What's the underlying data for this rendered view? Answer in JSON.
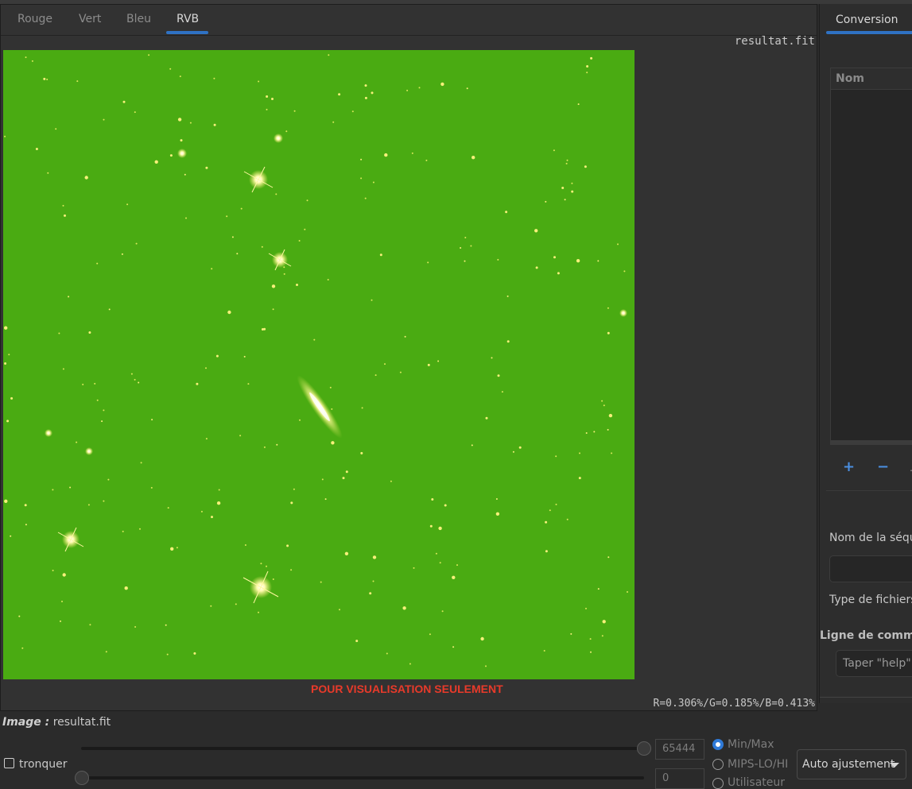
{
  "viewer": {
    "tabs": [
      "Rouge",
      "Vert",
      "Bleu",
      "RVB"
    ],
    "active_tab": "RVB",
    "filename": "resultat.fit",
    "watermark": "POUR VISUALISATION SEULEMENT",
    "pixel_readout": "R=0.306%/G=0.185%/B=0.413%"
  },
  "right_panel": {
    "tab": "Conversion",
    "list_header": "Nom",
    "add_symbol": "+",
    "remove_symbol": "−",
    "sequence_name_label": "Nom de la séqu",
    "file_type_label": "Type de fichiers",
    "command_line_label": "Ligne de comman",
    "command_placeholder": "Taper \"help\" p"
  },
  "bottom": {
    "image_label": "Image :",
    "image_name": "resultat.fit",
    "high_value": "65444",
    "low_value": "0",
    "clip_label": "tronquer",
    "radio_options": [
      "Min/Max",
      "MIPS-LO/HI",
      "Utilisateur"
    ],
    "selected_radio": "Min/Max",
    "mode_select": "Auto ajustement"
  },
  "colors": {
    "accent": "#2f72c4",
    "image_green": "#4aab12",
    "watermark_red": "#e83a2a"
  }
}
